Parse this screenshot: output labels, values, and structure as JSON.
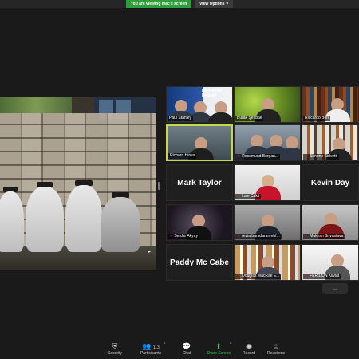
{
  "top_bar": {
    "share_banner": "You are viewing mac's screen",
    "view_options": "View Options"
  },
  "shared_screen": {
    "subject": "outdoor photo: white-shrouded figures seated by a stone wall"
  },
  "gallery": {
    "tiles": [
      {
        "label": "Paul Stanley",
        "style": "poster",
        "poster_title": "Mansecher Değhall",
        "muted": false
      },
      {
        "label": "Burak Şenbak",
        "style": "green",
        "muted": false
      },
      {
        "label": "Riccardo Bon",
        "style": "books",
        "muted": false
      },
      {
        "label": "Richard Hines",
        "style": "office",
        "muted": false,
        "active": true
      },
      {
        "label": "Rosamund Borgan...",
        "style": "group",
        "muted": true
      },
      {
        "label": "Simone Salvetti",
        "style": "shelf2",
        "muted": true
      },
      {
        "big_name": "Mark Taylor"
      },
      {
        "label": "Lale Cakli",
        "style": "light",
        "muted": true
      },
      {
        "big_name": "Kevin Day"
      },
      {
        "label": "Serdar Akyay",
        "style": "dark",
        "muted": true
      },
      {
        "label": "rezia baradaran ebf...",
        "style": "gray",
        "muted": true
      },
      {
        "label": "Mukesh Srivastava",
        "style": "red",
        "muted": true
      },
      {
        "big_name": "Paddy Mc Cabe"
      },
      {
        "label": "Douglas MacRae E...",
        "style": "shelf3",
        "muted": true
      },
      {
        "label": "FERIDUN Kliviat",
        "style": "bright",
        "muted": true
      }
    ]
  },
  "toolbar": {
    "security": "Security",
    "participants": "Participants",
    "participants_count": "113",
    "chat": "Chat",
    "share_screen": "Share Screen",
    "record": "Record",
    "reactions": "Reactions"
  },
  "colors": {
    "share_green": "#2e9f3a",
    "active_speaker": "#c7d94a",
    "muted_red": "#ff0044"
  },
  "icons": {
    "security": "shield-icon",
    "participants": "people-icon",
    "chat": "chat-bubble-icon",
    "share_screen": "share-arrow-icon",
    "record": "record-icon",
    "reactions": "emoji-plus-icon",
    "scroll": "chevron-down-icon"
  }
}
